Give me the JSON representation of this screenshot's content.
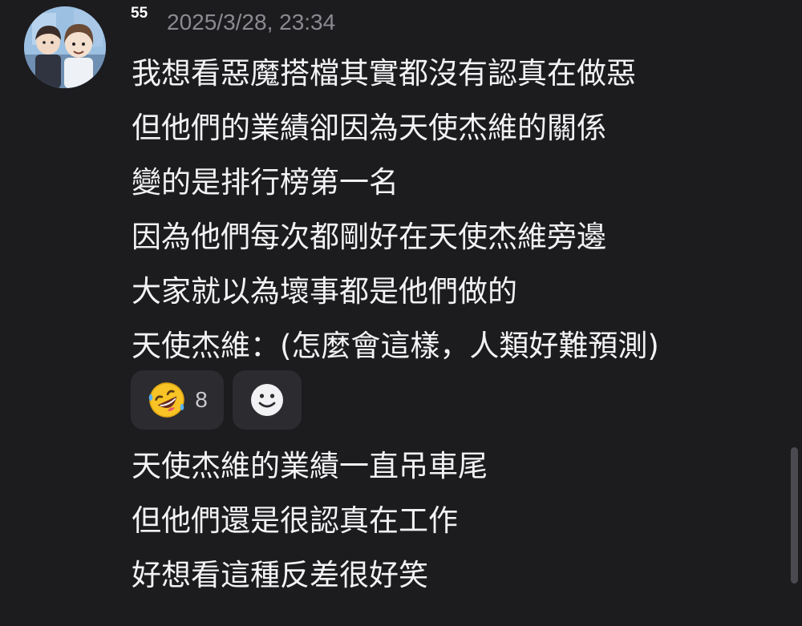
{
  "post": {
    "username": "55",
    "timestamp": "2025/3/28, 23:34",
    "lines": [
      "我想看惡魔搭檔其實都沒有認真在做惡",
      "但他們的業績卻因為天使杰維的關係",
      "變的是排行榜第一名",
      "因為他們每次都剛好在天使杰維旁邊",
      "大家就以為壞事都是他們做的",
      "天使杰維：(怎麼會這樣，人類好難預測)"
    ]
  },
  "reactions": {
    "items": [
      {
        "icon": "rolling-on-floor-laughing-icon",
        "count": "8"
      }
    ],
    "add_icon": "smiley-face-icon"
  },
  "reply": {
    "lines": [
      "天使杰維的業績一直吊車尾",
      "但他們還是很認真在工作",
      "好想看這種反差很好笑"
    ]
  },
  "colors": {
    "background": "#1c1c1f",
    "text": "#f2f2f4",
    "muted": "#8a8a90",
    "pill": "#2b2b30"
  }
}
